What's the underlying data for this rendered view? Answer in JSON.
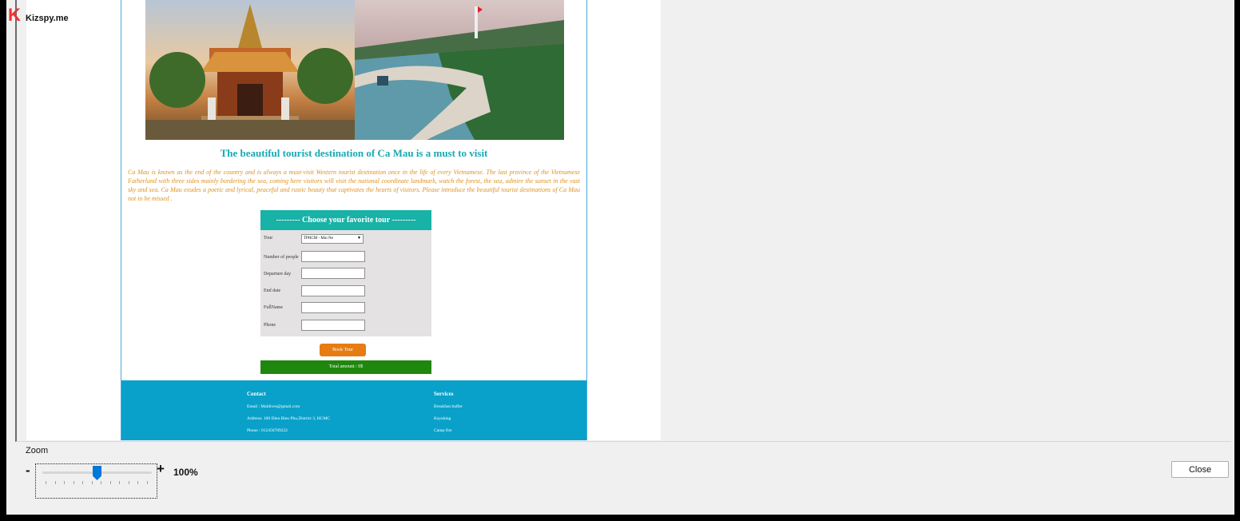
{
  "logo": {
    "letter": "K",
    "text": "Kizspy.me"
  },
  "document": {
    "headline": "The beautiful tourist destination of Ca Mau is a must to visit",
    "intro": "Ca Mau is known as the end of the country and is always a must-visit Western tourist destination once in the life of every Vietnamese. The last province of the Vietnamese Fatherland with three sides mainly bordering the sea, coming here visitors will visit the national coordinate landmark, watch the forest, the sea, admire the sunset in the vast sky and sea. Ca Mau exudes a poetic and lyrical, peaceful and rustic beauty that captivates the hearts of visitors. Please introduce the beautiful tourist destinations of Ca Mau not to be missed .",
    "form": {
      "title": "--------- Choose your favorite tour ---------",
      "tour_label": "Tour",
      "tour_value": "TPHCM - Mui Ne",
      "people_label": "Number of people",
      "departure_label": "Departure day",
      "end_label": "End date",
      "fullname_label": "FullName",
      "phone_label": "Phone"
    },
    "book_button": "Book Tour",
    "total": "Total amount : 0$",
    "footer": {
      "contact_title": "Contact",
      "contact_items": [
        "Email : Maldives@gmail.com",
        "Address: 100 Dien Bien Phu,District 3, HCMC",
        "Phone : 012456789222"
      ],
      "services_title": "Services",
      "services_items": [
        "Breakfast buffet",
        "Kayaking",
        "Camp-fire"
      ]
    }
  },
  "zoom": {
    "label": "Zoom",
    "minus": "-",
    "plus": "+",
    "value": "100%",
    "level_fraction": 0.5
  },
  "close_button": "Close"
}
